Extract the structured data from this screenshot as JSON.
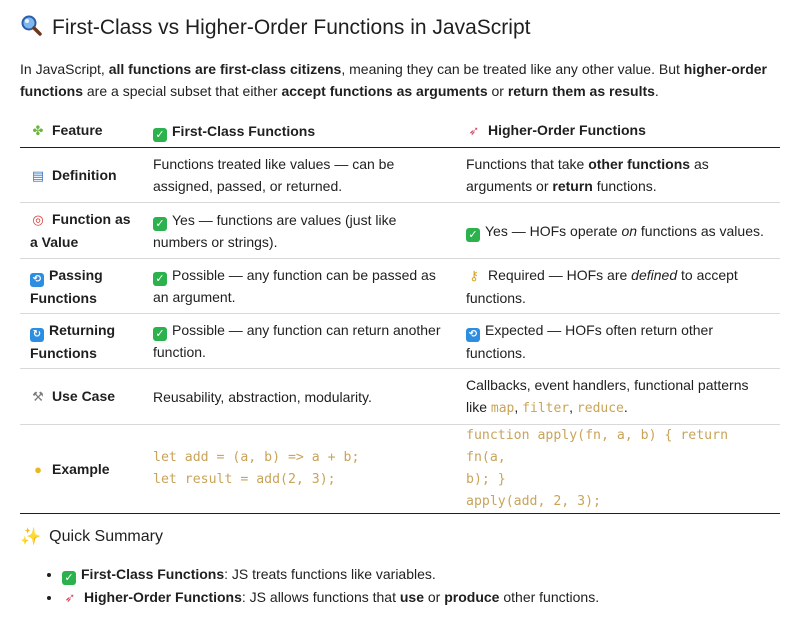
{
  "title": {
    "icon": "magnifier-icon",
    "text": "First-Class vs Higher-Order Functions in JavaScript"
  },
  "intro": {
    "t1": "In JavaScript, ",
    "b1": "all functions are first-class citizens",
    "t2": ", meaning they can be treated like any other value. But ",
    "b2": "higher-order functions",
    "t3": " are a special subset that either ",
    "b3": "accept functions as arguments",
    "t4": " or ",
    "b4": "return them as results",
    "t5": "."
  },
  "table": {
    "headers": {
      "feature": "Feature",
      "first_class": "First-Class Functions",
      "higher_order": "Higher-Order Functions"
    },
    "rows": {
      "definition": {
        "feature": "Definition",
        "first_class": "Functions treated like values — can be assigned, passed, or returned.",
        "ho_t1": "Functions that take ",
        "ho_b1": "other functions",
        "ho_t2": " as arguments or ",
        "ho_b2": "return",
        "ho_t3": " functions."
      },
      "value": {
        "feature": "Function as a Value",
        "first_class": "Yes — functions are values (just like numbers or strings).",
        "ho_t1": "Yes — HOFs operate ",
        "ho_i1": "on",
        "ho_t2": " functions as values."
      },
      "passing": {
        "feature": "Passing Functions",
        "first_class": "Possible — any function can be passed as an argument.",
        "ho_t1": "Required — HOFs are ",
        "ho_i1": "defined",
        "ho_t2": " to accept functions."
      },
      "returning": {
        "feature": "Returning Functions",
        "first_class": "Possible — any function can return another function.",
        "higher_order": "Expected — HOFs often return other functions."
      },
      "usecase": {
        "feature": "Use Case",
        "first_class": "Reusability, abstraction, modularity.",
        "ho_t1": "Callbacks, event handlers, functional patterns like ",
        "ho_c1": "map",
        "ho_sep1": ", ",
        "ho_c2": "filter",
        "ho_sep2": ", ",
        "ho_c3": "reduce",
        "ho_t2": "."
      },
      "example": {
        "feature": "Example",
        "first_class_line1": "let add = (a, b) => a + b;",
        "first_class_line2": "let result = add(2, 3);",
        "ho_line1": "function apply(fn, a, b) { return fn(a,",
        "ho_line2": "b); }",
        "ho_line3": "apply(add, 2, 3);"
      }
    }
  },
  "summary": {
    "icon": "sparkles-icon",
    "heading": "Quick Summary",
    "item1_label": "First-Class Functions",
    "item1_text": ": JS treats functions like variables.",
    "item2_label": "Higher-Order Functions",
    "item2_t1": ": JS allows functions that ",
    "item2_b1": "use",
    "item2_t2": " or ",
    "item2_b2": "produce",
    "item2_t3": " other functions."
  }
}
